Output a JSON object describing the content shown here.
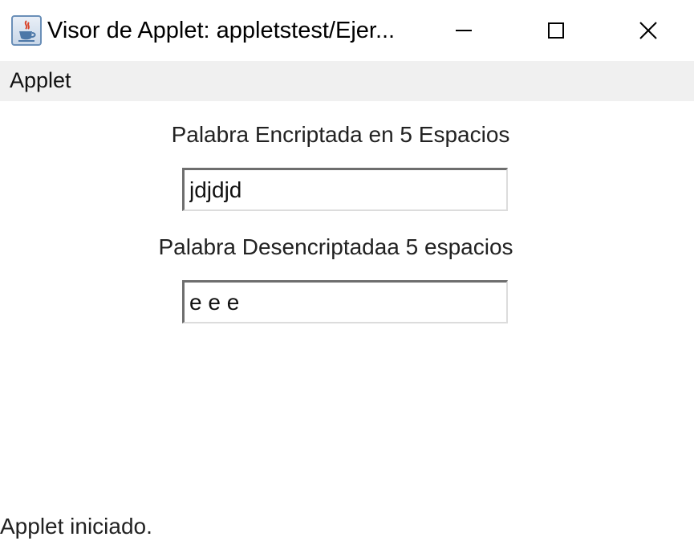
{
  "window": {
    "title": "Visor de Applet: appletstest/Ejer...",
    "controls": {
      "minimize_icon": "minimize-icon",
      "maximize_icon": "maximize-icon",
      "close_icon": "close-icon"
    }
  },
  "menubar": {
    "items": [
      {
        "label": "Applet"
      }
    ]
  },
  "content": {
    "encrypted_label": "Palabra Encriptada en 5 Espacios",
    "encrypted_value": "jdjdjd",
    "decrypted_label": "Palabra Desencriptadaa 5 espacios",
    "decrypted_value": "e e e"
  },
  "status": {
    "text": "Applet iniciado."
  },
  "colors": {
    "menubar_bg": "#f0f0f0",
    "window_bg": "#ffffff"
  }
}
